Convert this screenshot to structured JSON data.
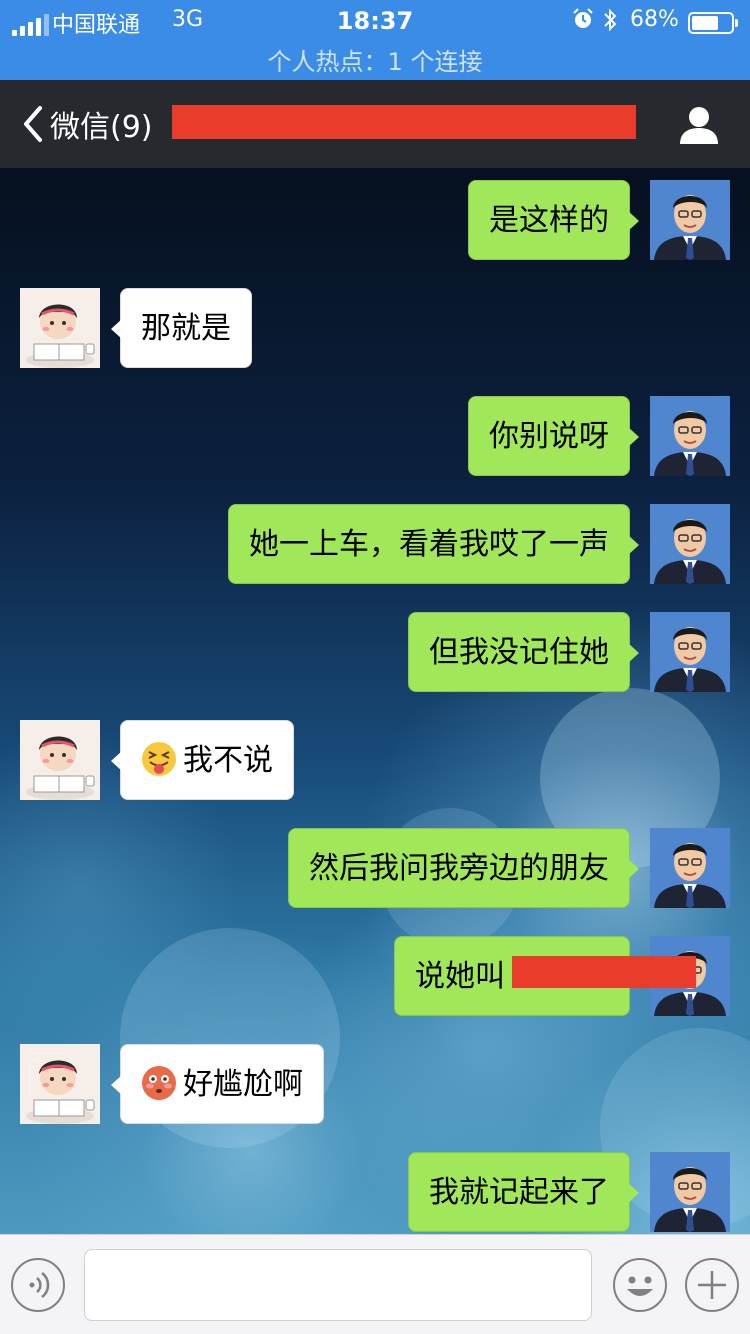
{
  "status_bar": {
    "carrier": "中国联通",
    "network": "3G",
    "time": "18:37",
    "battery_percent": "68%",
    "battery_level": 0.68,
    "hotspot": "个人热点：1 个连接"
  },
  "nav": {
    "back_label": "微信(9)"
  },
  "messages": [
    {
      "side": "self",
      "text": "是这样的"
    },
    {
      "side": "friend",
      "text": "那就是"
    },
    {
      "side": "self",
      "text": "你别说呀"
    },
    {
      "side": "self",
      "text": "她一上车，看着我哎了一声"
    },
    {
      "side": "self",
      "text": "但我没记住她"
    },
    {
      "side": "friend",
      "text": "我不说",
      "emoji": "tongue-out-emoji"
    },
    {
      "side": "self",
      "text": "然后我问我旁边的朋友"
    },
    {
      "side": "self",
      "text": "说她叫",
      "redacted": true
    },
    {
      "side": "friend",
      "text": "好尴尬啊",
      "emoji": "flushed-emoji"
    },
    {
      "side": "self",
      "text": "我就记起来了"
    }
  ],
  "input_bar": {
    "text": ""
  },
  "colors": {
    "status_bar": "#3b8ce6",
    "nav_bar": "#262a2f",
    "bubble_self": "#a0e75a",
    "bubble_friend": "#ffffff",
    "redaction": "#ea3c2a"
  },
  "icons": {
    "back": "chevron-left-icon",
    "profile": "person-icon",
    "voice": "voice-icon",
    "emoji": "smiley-icon",
    "more": "plus-icon"
  }
}
